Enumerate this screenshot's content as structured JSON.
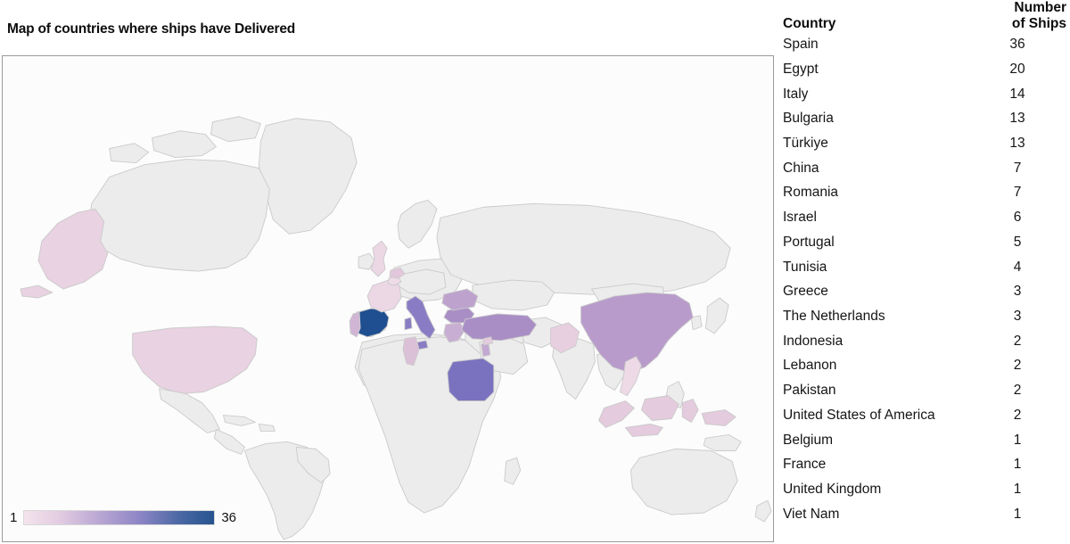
{
  "map": {
    "title": "Map of countries where ships have Delivered",
    "legend": {
      "min_label": "1",
      "max_label": "36",
      "gradient_start": "#f2dfe9",
      "gradient_mid": "#9b8bc9",
      "gradient_end": "#27548f"
    },
    "colors": {
      "ocean": "#fcfcfc",
      "land_default": "#ececec",
      "border": "#c9c9c9",
      "frame": "#9a9a9a"
    },
    "country_fills": [
      {
        "name": "Spain",
        "value": 36,
        "color": "#1f4f91"
      },
      {
        "name": "Egypt",
        "value": 20,
        "color": "#7b72bf"
      },
      {
        "name": "Italy",
        "value": 14,
        "color": "#8a7cc4"
      },
      {
        "name": "Bulgaria",
        "value": 13,
        "color": "#a98ec6"
      },
      {
        "name": "Türkiye",
        "value": 13,
        "color": "#a98ec6"
      },
      {
        "name": "China",
        "value": 7,
        "color": "#b89bcb"
      },
      {
        "name": "Romania",
        "value": 7,
        "color": "#bda2ce"
      },
      {
        "name": "Israel",
        "value": 6,
        "color": "#c3a9d1"
      },
      {
        "name": "Portugal",
        "value": 5,
        "color": "#d0b5d5"
      },
      {
        "name": "Tunisia",
        "value": 4,
        "color": "#dcc0d8"
      },
      {
        "name": "Greece",
        "value": 3,
        "color": "#c9aed3"
      },
      {
        "name": "The Netherlands",
        "value": 3,
        "color": "#e2c7dc"
      },
      {
        "name": "Indonesia",
        "value": 2,
        "color": "#e4cbdd"
      },
      {
        "name": "Lebanon",
        "value": 2,
        "color": "#e4cbdd"
      },
      {
        "name": "Pakistan",
        "value": 2,
        "color": "#e8cfe0"
      },
      {
        "name": "United States of America",
        "value": 2,
        "color": "#e9d2e1"
      },
      {
        "name": "Belgium",
        "value": 1,
        "color": "#efdbe8"
      },
      {
        "name": "France",
        "value": 1,
        "color": "#ecd7e5"
      },
      {
        "name": "United Kingdom",
        "value": 1,
        "color": "#ecd7e5"
      },
      {
        "name": "Viet Nam",
        "value": 1,
        "color": "#eedae7"
      }
    ]
  },
  "table": {
    "headers": {
      "country": "Country",
      "ships_line1": "Number",
      "ships_line2": "of Ships"
    },
    "rows": [
      {
        "country": "Spain",
        "ships": "36"
      },
      {
        "country": "Egypt",
        "ships": "20"
      },
      {
        "country": "Italy",
        "ships": "14"
      },
      {
        "country": "Bulgaria",
        "ships": "13"
      },
      {
        "country": "Türkiye",
        "ships": "13"
      },
      {
        "country": "China",
        "ships": "7"
      },
      {
        "country": "Romania",
        "ships": "7"
      },
      {
        "country": "Israel",
        "ships": "6"
      },
      {
        "country": "Portugal",
        "ships": "5"
      },
      {
        "country": "Tunisia",
        "ships": "4"
      },
      {
        "country": "Greece",
        "ships": "3"
      },
      {
        "country": "The Netherlands",
        "ships": "3"
      },
      {
        "country": "Indonesia",
        "ships": "2"
      },
      {
        "country": "Lebanon",
        "ships": "2"
      },
      {
        "country": "Pakistan",
        "ships": "2"
      },
      {
        "country": "United States of America",
        "ships": "2"
      },
      {
        "country": "Belgium",
        "ships": "1"
      },
      {
        "country": "France",
        "ships": "1"
      },
      {
        "country": "United Kingdom",
        "ships": "1"
      },
      {
        "country": "Viet Nam",
        "ships": "1"
      }
    ]
  },
  "chart_data": {
    "type": "map",
    "title": "Map of countries where ships have Delivered",
    "value_label": "Number of Ships",
    "categories": [
      "Spain",
      "Egypt",
      "Italy",
      "Bulgaria",
      "Türkiye",
      "China",
      "Romania",
      "Israel",
      "Portugal",
      "Tunisia",
      "Greece",
      "The Netherlands",
      "Indonesia",
      "Lebanon",
      "Pakistan",
      "United States of America",
      "Belgium",
      "France",
      "United Kingdom",
      "Viet Nam"
    ],
    "values": [
      36,
      20,
      14,
      13,
      13,
      7,
      7,
      6,
      5,
      4,
      3,
      3,
      2,
      2,
      2,
      2,
      1,
      1,
      1,
      1
    ],
    "color_scale": {
      "min": 1,
      "max": 36,
      "low_color": "#f2dfe9",
      "high_color": "#27548f"
    },
    "projection": "world-equirectangular",
    "legend_position": "bottom-left"
  }
}
